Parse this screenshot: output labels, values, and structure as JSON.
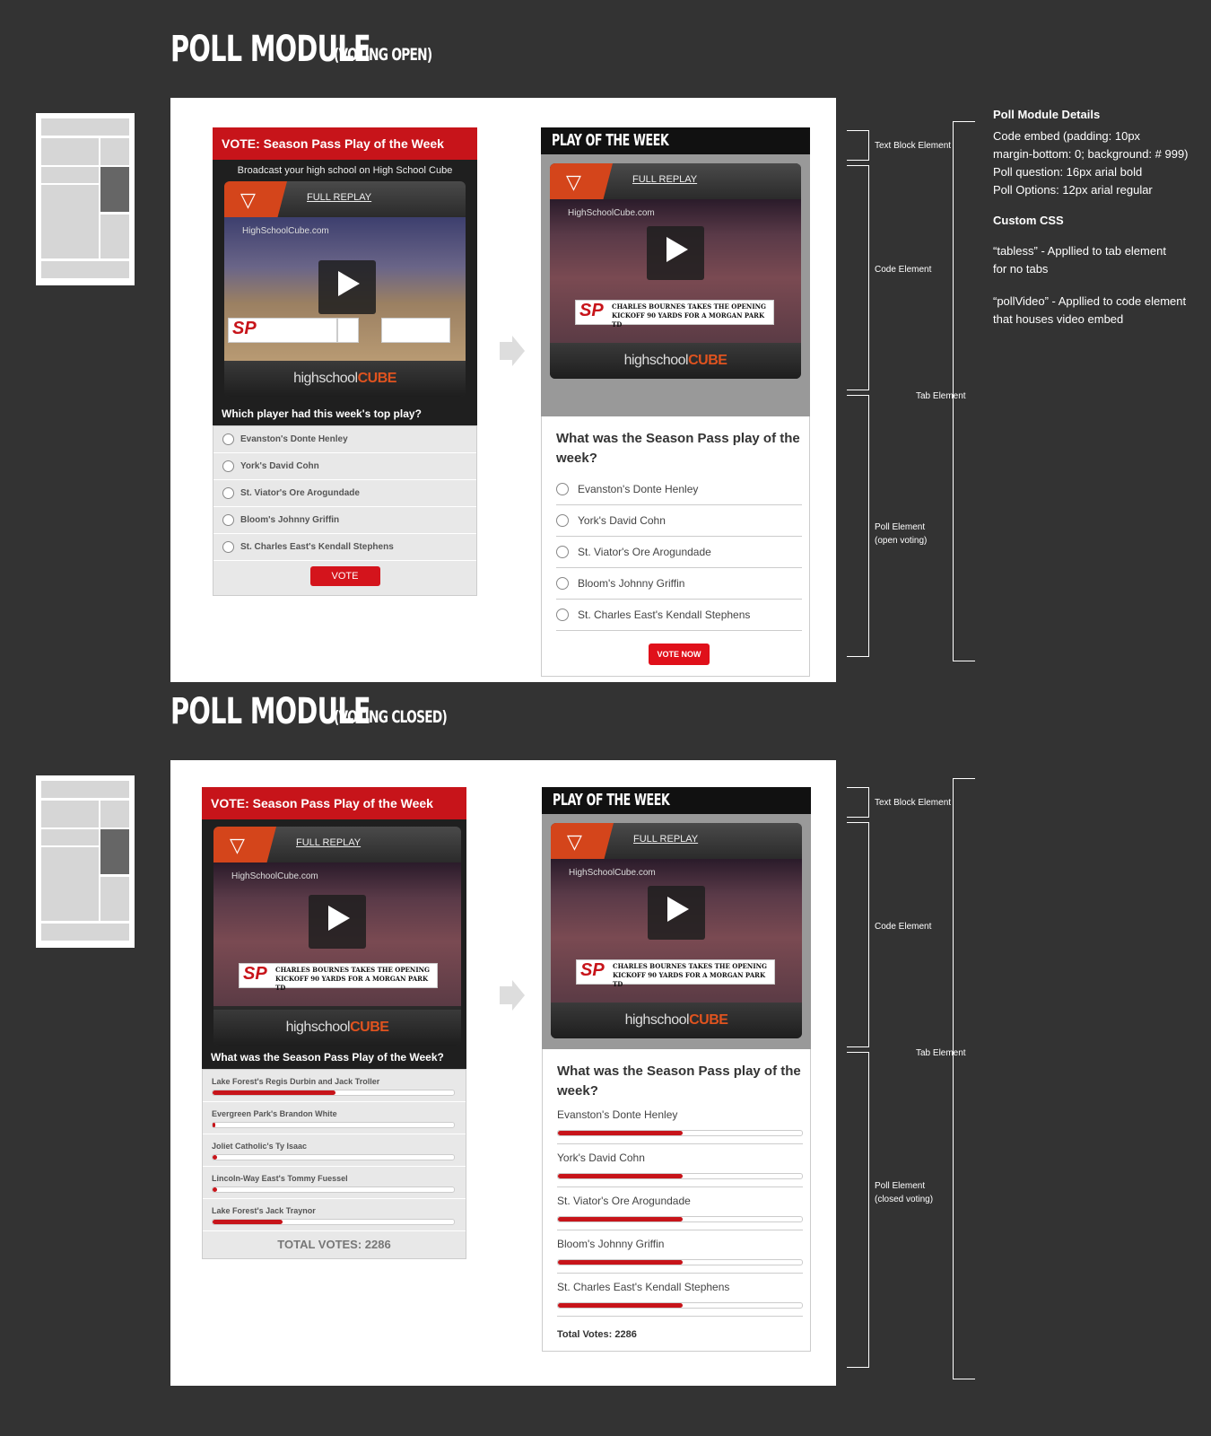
{
  "sections": {
    "open": {
      "title": "POLL MODULE",
      "subtitle": "(VOTING OPEN)"
    },
    "closed": {
      "title": "POLL MODULE",
      "subtitle": "(VOTING CLOSED)"
    }
  },
  "video": {
    "replay_label": "FULL REPLAY",
    "watermark": "HighSchoolCube.com",
    "brand_prefix": "highschool",
    "brand_suffix": "CUBE",
    "sp_label": "SP",
    "caption_line1": "CHARLES BOURNES TAKES THE OPENING",
    "caption_line2": "KICKOFF 90 YARDS FOR A MORGAN PARK TD"
  },
  "open_left": {
    "header": "VOTE: Season Pass Play of the Week",
    "subheader": "Broadcast your high school on High School Cube",
    "question": "Which player had this week's top play?",
    "options": [
      "Evanston's Donte Henley",
      "York's David Cohn",
      "St. Viator's Ore Arogundade",
      "Bloom's Johnny Griffin",
      "St. Charles East's Kendall Stephens"
    ],
    "vote_label": "VOTE"
  },
  "open_right": {
    "header": "PLAY OF THE WEEK",
    "question": "What was the Season Pass play of the week?",
    "options": [
      "Evanston's Donte Henley",
      "York's David Cohn",
      "St. Viator's Ore Arogundade",
      "Bloom's Johnny Griffin",
      "St. Charles East's Kendall Stephens"
    ],
    "vote_label": "VOTE NOW"
  },
  "closed_left": {
    "header": "VOTE: Season Pass Play of the Week",
    "question": "What was the Season Pass Play of the Week?",
    "results": [
      {
        "name": "Lake Forest's Regis Durbin and Jack Troller",
        "pct": 0.51
      },
      {
        "name": "Evergreen Park's Brandon White",
        "pct": 0.01
      },
      {
        "name": "Joliet Catholic's Ty Isaac",
        "pct": 0.02
      },
      {
        "name": "Lincoln-Way East's Tommy Fuessel",
        "pct": 0.02
      },
      {
        "name": "Lake Forest's Jack Traynor",
        "pct": 0.29
      }
    ],
    "total_label": "TOTAL VOTES: 2286"
  },
  "closed_right": {
    "header": "PLAY OF THE WEEK",
    "question": "What was the Season Pass play of the week?",
    "results": [
      {
        "name": "Evanston's Donte Henley",
        "pct": 0.51
      },
      {
        "name": "York's David Cohn",
        "pct": 0.51
      },
      {
        "name": "St. Viator's Ore Arogundade",
        "pct": 0.51
      },
      {
        "name": "Bloom's Johnny Griffin",
        "pct": 0.51
      },
      {
        "name": "St. Charles East's Kendall Stephens",
        "pct": 0.51
      }
    ],
    "total_label": "Total Votes: 2286"
  },
  "annotations": {
    "text_block": "Text Block Element",
    "code": "Code Element",
    "tab": "Tab Element",
    "poll_open_1": "Poll Element",
    "poll_open_2": "(open voting)",
    "poll_closed_1": "Poll Element",
    "poll_closed_2": "(closed voting)"
  },
  "details": {
    "heading": "Poll Module Details",
    "lines": [
      "Code embed (padding: 10px",
      "margin-bottom: 0; background: # 999)",
      "Poll question: 16px arial bold",
      "Poll Options: 12px arial regular"
    ],
    "css_heading": "Custom CSS",
    "tabless_1": "“tabless” - Appllied to tab element",
    "tabless_2": "for no tabs",
    "pollvideo_1": "“pollVideo” - Appllied to code element",
    "pollvideo_2": "that houses video embed"
  },
  "colors": {
    "accent": "#c7141a",
    "bg": "#333333",
    "code_bg": "#999999"
  }
}
